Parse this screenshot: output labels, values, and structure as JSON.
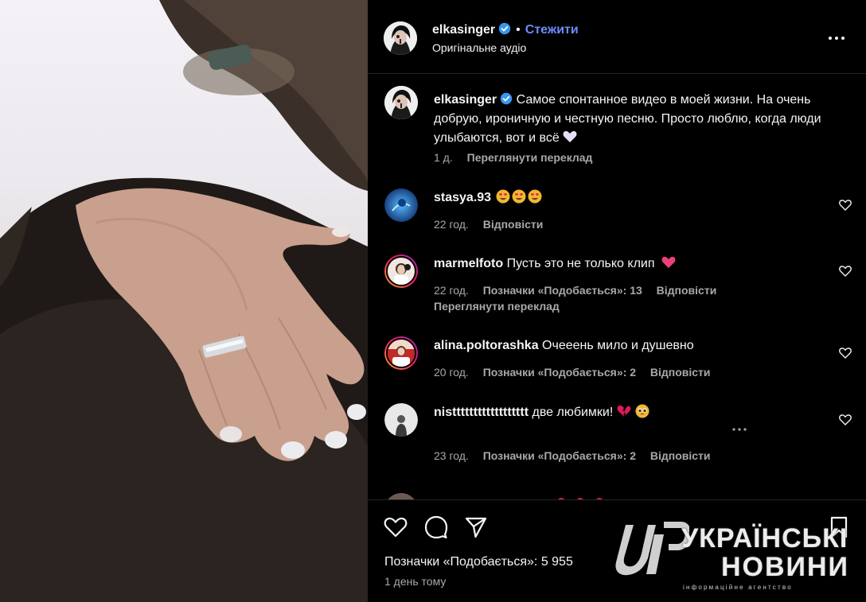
{
  "post": {
    "username": "elkasinger",
    "follow_label": "Стежити",
    "audio_label": "Оригінальне аудіо",
    "caption_text": "Самое спонтанное видео в моей жизни. На очень добрую, ироничную и честную песню. Просто люблю, когда люди улыбаются, вот и всё",
    "caption_time": "1 д.",
    "caption_translate": "Переглянути переклад"
  },
  "comments": [
    {
      "username": "stasya.93",
      "text": "",
      "time": "22 год.",
      "likes": "",
      "reply": "Відповісти"
    },
    {
      "username": "marmelfoto",
      "text": "Пусть это не только клип",
      "time": "22 год.",
      "likes": "Позначки «Подобається»: 13",
      "reply": "Відповісти",
      "translate": "Переглянути переклад"
    },
    {
      "username": "alina.poltorashka",
      "text": "Очееень мило и душевно",
      "time": "20 год.",
      "likes": "Позначки «Подобається»: 2",
      "reply": "Відповісти"
    },
    {
      "username": "nistttttttttttttttttt",
      "text": "две любимки!",
      "time": "23 год.",
      "likes": "Позначки «Подобається»: 2",
      "reply": "Відповісти"
    }
  ],
  "footer": {
    "likes_text": "Позначки «Подобається»: 5 955",
    "time_text": "1 день тому"
  },
  "watermark": {
    "line1": "УКРАЇНСЬКІ",
    "line2": "НОВИНИ",
    "line3": "інформаційне агентство"
  },
  "icons": {
    "like": "heart-icon",
    "comment": "comment-icon",
    "share": "share-icon",
    "save": "bookmark-icon",
    "more": "more-icon",
    "verified": "verified-badge-icon"
  },
  "colors": {
    "background": "#000000",
    "text": "#f5f5f5",
    "muted": "#a8a8a8",
    "accent": "#6e8bff",
    "verified": "#3897f0"
  }
}
